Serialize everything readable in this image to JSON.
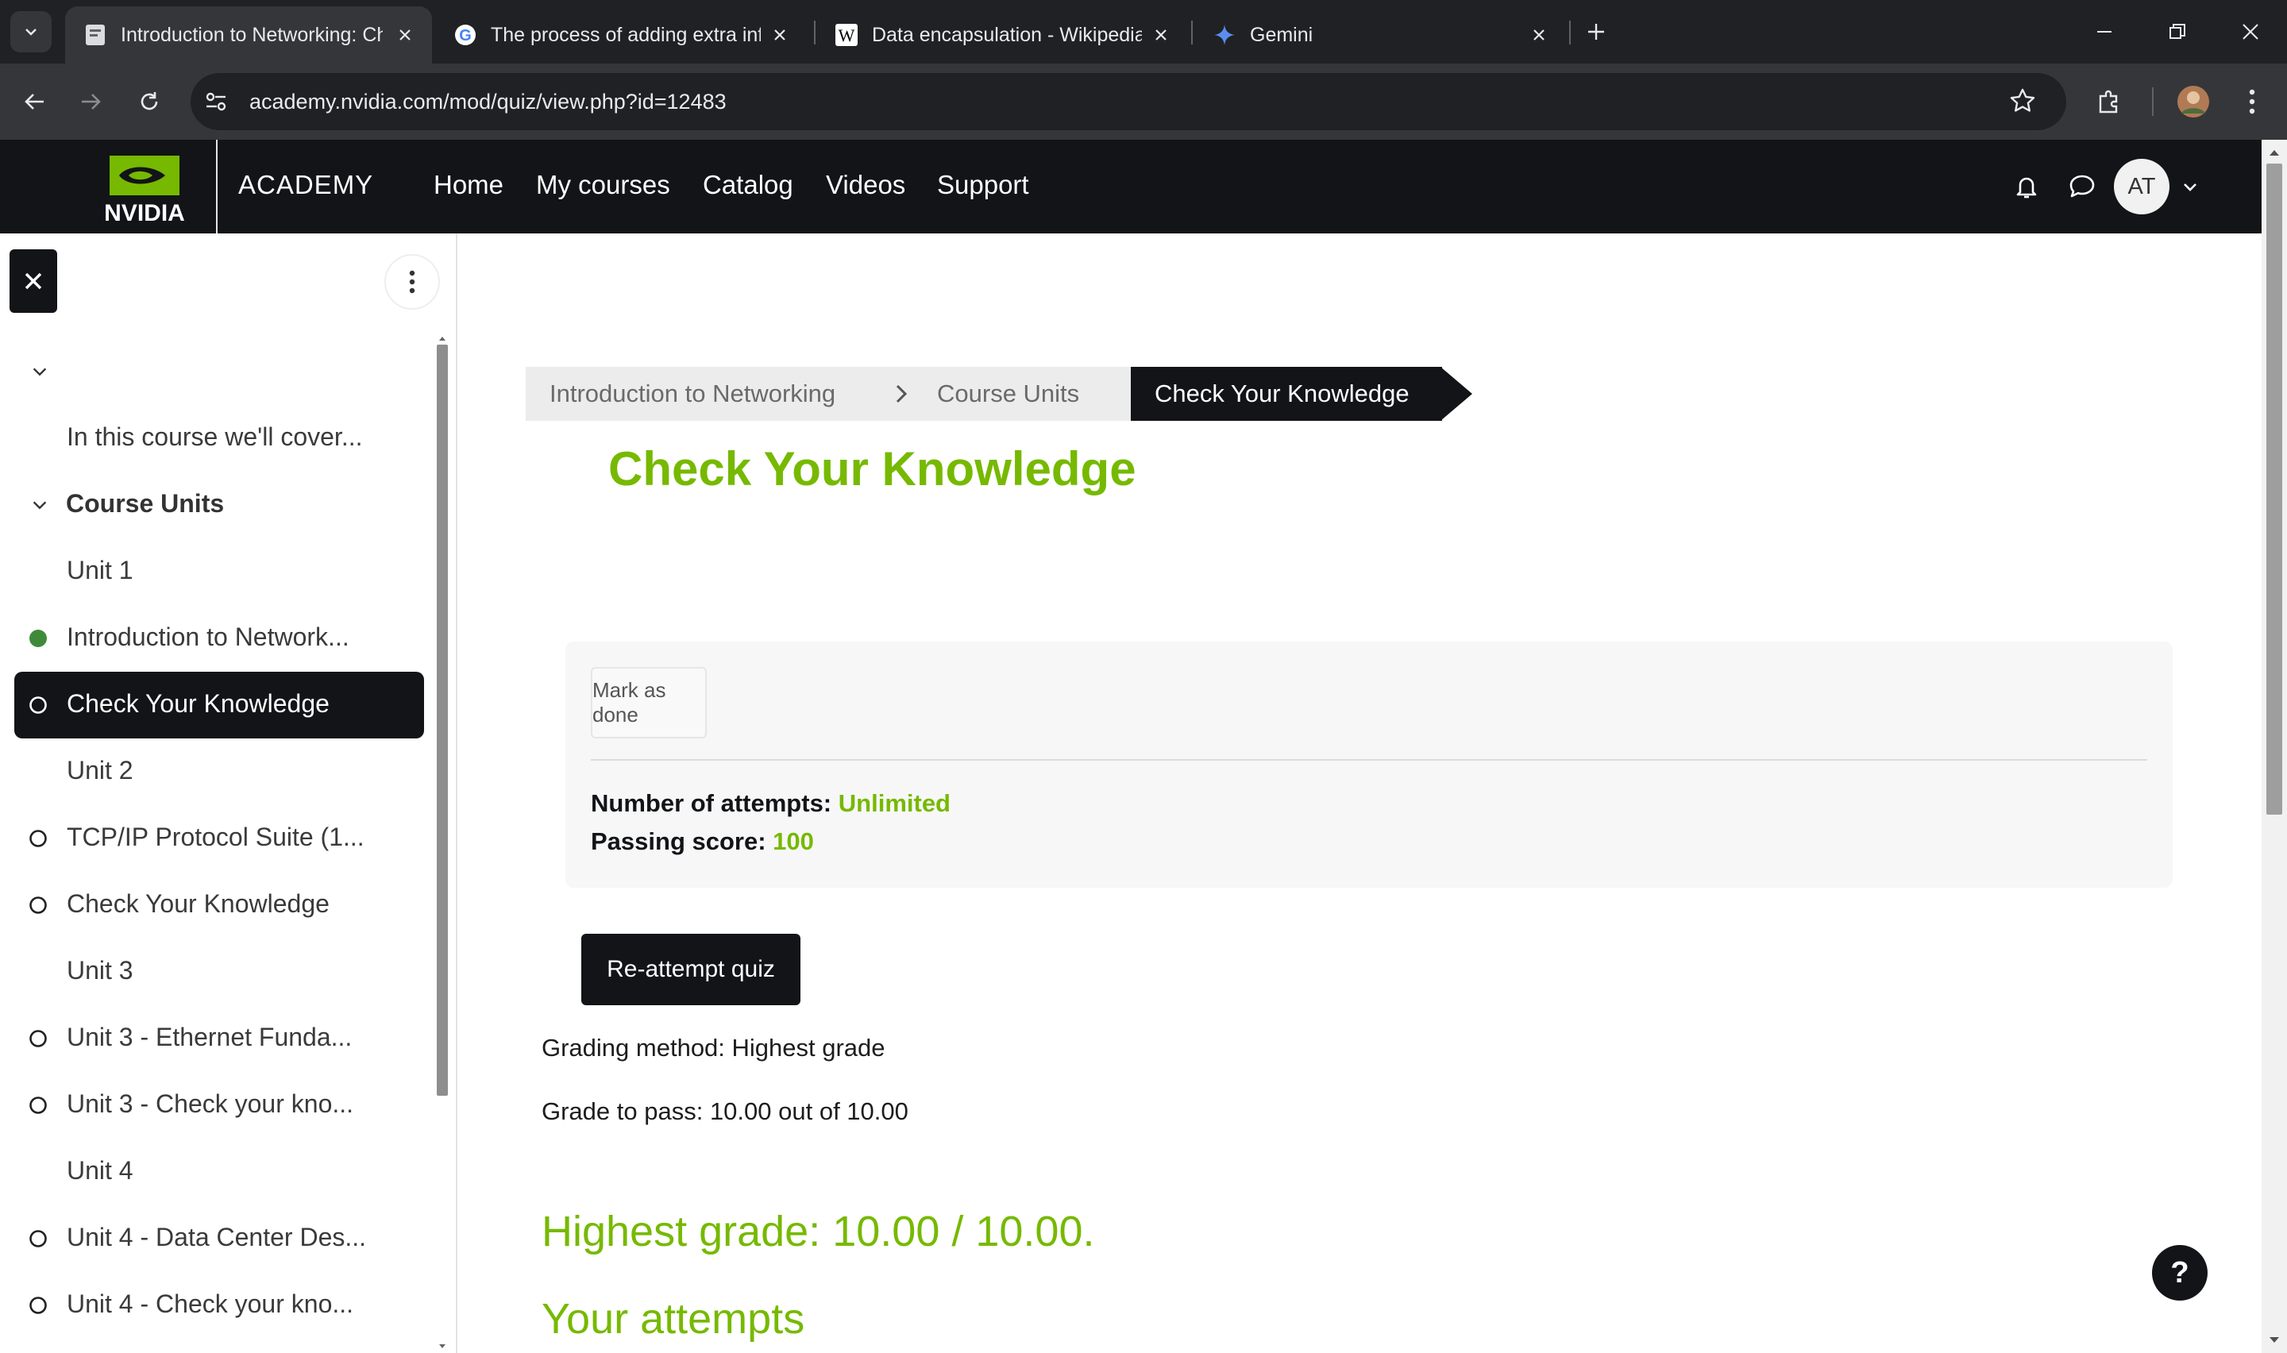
{
  "browser": {
    "tabs": [
      {
        "title": "Introduction to Networking: Ch",
        "favicon": "nvidia-doc-icon",
        "active": true
      },
      {
        "title": "The process of adding extra info",
        "favicon": "google-icon",
        "active": false
      },
      {
        "title": "Data encapsulation - Wikipedia",
        "favicon": "wikipedia-icon",
        "active": false
      },
      {
        "title": "Gemini",
        "favicon": "gemini-icon",
        "active": false
      }
    ],
    "url": "academy.nvidia.com/mod/quiz/view.php?id=12483"
  },
  "header": {
    "logo_text": "NVIDIA",
    "academy": "ACADEMY",
    "nav": [
      "Home",
      "My courses",
      "Catalog",
      "Videos",
      "Support"
    ],
    "avatar_initials": "AT"
  },
  "drawer": {
    "items": [
      {
        "label": "",
        "type": "collapse-toggle"
      },
      {
        "label": "In this course we'll cover...",
        "type": "item"
      },
      {
        "label": "Course Units",
        "type": "section"
      },
      {
        "label": "Unit 1",
        "type": "item"
      },
      {
        "label": "Introduction to Network...",
        "type": "done"
      },
      {
        "label": "Check Your Knowledge",
        "type": "active"
      },
      {
        "label": "Unit 2",
        "type": "item"
      },
      {
        "label": "TCP/IP Protocol Suite (1...",
        "type": "todo"
      },
      {
        "label": "Check Your Knowledge",
        "type": "todo"
      },
      {
        "label": "Unit 3",
        "type": "item"
      },
      {
        "label": "Unit 3 - Ethernet Funda...",
        "type": "todo"
      },
      {
        "label": "Unit 3 - Check your kno...",
        "type": "todo"
      },
      {
        "label": "Unit 4",
        "type": "item"
      },
      {
        "label": "Unit 4 - Data Center Des...",
        "type": "todo"
      },
      {
        "label": "Unit 4 - Check your kno...",
        "type": "todo"
      }
    ]
  },
  "main": {
    "breadcrumbs": [
      "Introduction to Networking",
      "Course Units",
      "Check Your Knowledge"
    ],
    "title": "Check Your Knowledge",
    "mark_done": "Mark as done",
    "attempts_label": "Number of attempts:",
    "attempts_value": "Unlimited",
    "passing_label": "Passing score:",
    "passing_value": "100",
    "reattempt": "Re-attempt quiz",
    "grading_method": "Grading method: Highest grade",
    "grade_to_pass": "Grade to pass: 10.00 out of 10.00",
    "highest_grade": "Highest grade: 10.00 / 10.00.",
    "your_attempts": "Your attempts",
    "help": "?"
  },
  "colors": {
    "accent_green": "#76b900",
    "header_dark": "#121417"
  }
}
